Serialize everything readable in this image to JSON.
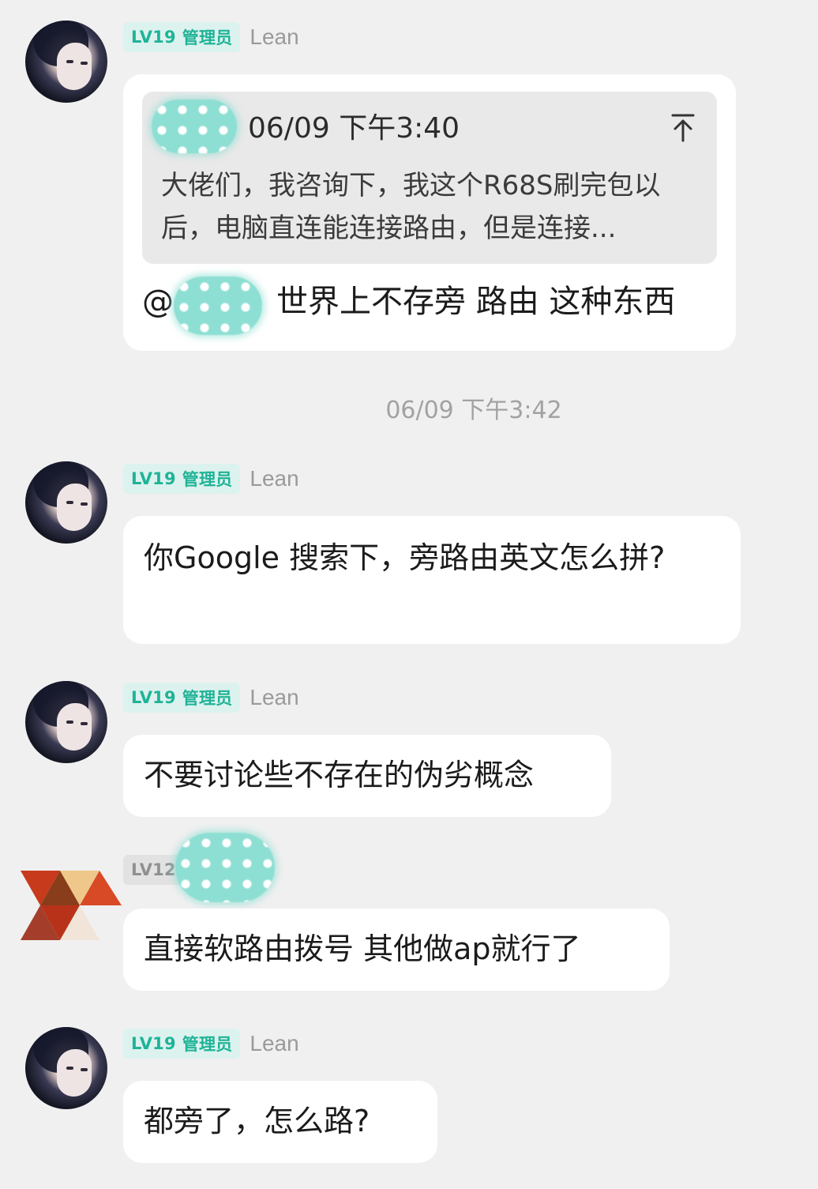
{
  "messages": [
    {
      "level": "LV19",
      "role": "管理员",
      "nickname": "Lean",
      "quote": {
        "time": "06/09 下午3:40",
        "text": "大佬们，我咨询下，我这个R68S刷完包以后，电脑直连能连接路由，但是连接..."
      },
      "mention": "@",
      "text": "世界上不存旁 路由 这种东西"
    },
    {
      "level": "LV19",
      "role": "管理员",
      "nickname": "Lean",
      "text": "你Google 搜索下，旁路由英文怎么拼?"
    },
    {
      "level": "LV19",
      "role": "管理员",
      "nickname": "Lean",
      "text": "不要讨论些不存在的伪劣概念"
    },
    {
      "level": "LV12",
      "role": "",
      "nickname": "",
      "text": "直接软路由拨号 其他做ap就行了"
    },
    {
      "level": "LV19",
      "role": "管理员",
      "nickname": "Lean",
      "text": "都旁了，怎么路?"
    }
  ],
  "timestamp_divider": "06/09 下午3:42",
  "colors": {
    "background": "#f0f0f0",
    "bubble": "#ffffff",
    "badge_green_bg": "#dcf2ee",
    "badge_green_text": "#1fb397",
    "quote_bg": "#e9e9e9"
  },
  "icons": {
    "quote_jump": "arrow-up-to-top-icon"
  }
}
